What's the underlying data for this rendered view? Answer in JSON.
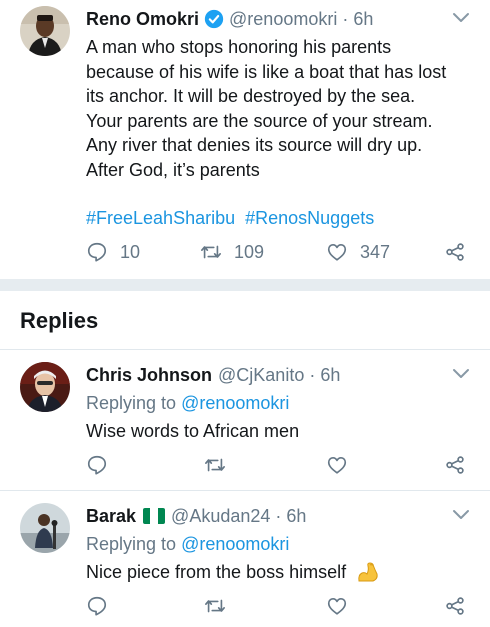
{
  "main_tweet": {
    "name": "Reno Omokri",
    "handle": "@renoomokri",
    "separator": "·",
    "time": "6h",
    "text_lines": [
      "A man who stops honoring his parents",
      "because of his wife is like a boat that has lost",
      "its anchor. It will be destroyed by the sea.",
      "Your parents are the source of your stream.",
      "Any river that denies its source will dry up.",
      "After God, it’s parents"
    ],
    "hashtags": [
      "#FreeLeahSharibu",
      "#RenosNuggets"
    ],
    "reply_count": "10",
    "retweet_count": "109",
    "like_count": "347"
  },
  "replies_section": {
    "title": "Replies"
  },
  "replies": [
    {
      "name": "Chris Johnson",
      "handle": "@CjKanito",
      "separator": "·",
      "time": "6h",
      "replying_label": "Replying to",
      "replying_handle": "@renoomokri",
      "text": "Wise words to African men"
    },
    {
      "name": "Barak",
      "flag": "🇳🇬",
      "handle": "@Akudan24",
      "separator": "·",
      "time": "6h",
      "replying_label": "Replying to",
      "replying_handle": "@renoomokri",
      "text": "Nice piece from the boss himself",
      "emoji": "💪"
    }
  ],
  "colors": {
    "link": "#1b95e0",
    "muted": "#657786",
    "divider": "#e1e8ed",
    "verified": "#1da1f2"
  },
  "icons": [
    "verified-icon",
    "chevron-down-icon",
    "reply-icon",
    "retweet-icon",
    "like-icon",
    "share-icon"
  ]
}
